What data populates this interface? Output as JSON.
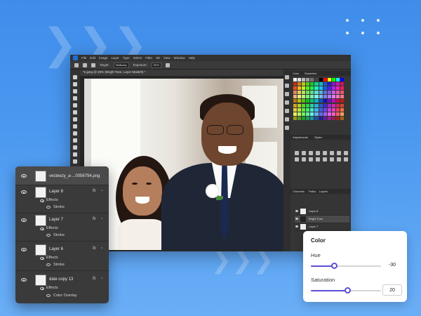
{
  "menu": [
    "File",
    "Edit",
    "Image",
    "Layer",
    "Type",
    "Select",
    "Filter",
    "3D",
    "View",
    "Window",
    "Help"
  ],
  "options": {
    "target_label": "Target:",
    "target_value": "Walkway",
    "exposure_label": "Exposure:",
    "exposure_value": "50%"
  },
  "document_tab": "*e.jpeg @ 25% (Bright Tone, Layer Mask/8) *",
  "right_panel": {
    "swatches_tabs": [
      "Color",
      "Swatches"
    ],
    "adjust_tabs": [
      "Adjustments",
      "Styles"
    ],
    "layers_tabs": [
      "Channels",
      "Paths",
      "Layers"
    ],
    "layer_rows": [
      "Layer 8",
      "Bright Tone",
      "Layer 7"
    ]
  },
  "layers_panel": {
    "top_layer": "vecteezy_a-...0056794.png",
    "layers": [
      {
        "name": "Layer 8",
        "effects": "Effects",
        "effect": "Stroke"
      },
      {
        "name": "Layer 7",
        "effects": "Effects",
        "effect": "Stroke"
      },
      {
        "name": "Layer 6",
        "effects": "Effects",
        "effect": "Stroke"
      },
      {
        "name": "date copy 13",
        "effects": "Effects",
        "effect": "Color Overlay"
      }
    ],
    "fx_label": "fx"
  },
  "color_card": {
    "title": "Color",
    "hue": {
      "label": "Hue",
      "value": "-30",
      "position": 0.33
    },
    "saturation": {
      "label": "Saturation",
      "value": "20",
      "position": 0.52
    },
    "accent": "#5b4fd6"
  },
  "colors": {
    "background": "#4a98f0",
    "ps_dark": "#2b2b2b",
    "panel": "#3a3a3a"
  }
}
